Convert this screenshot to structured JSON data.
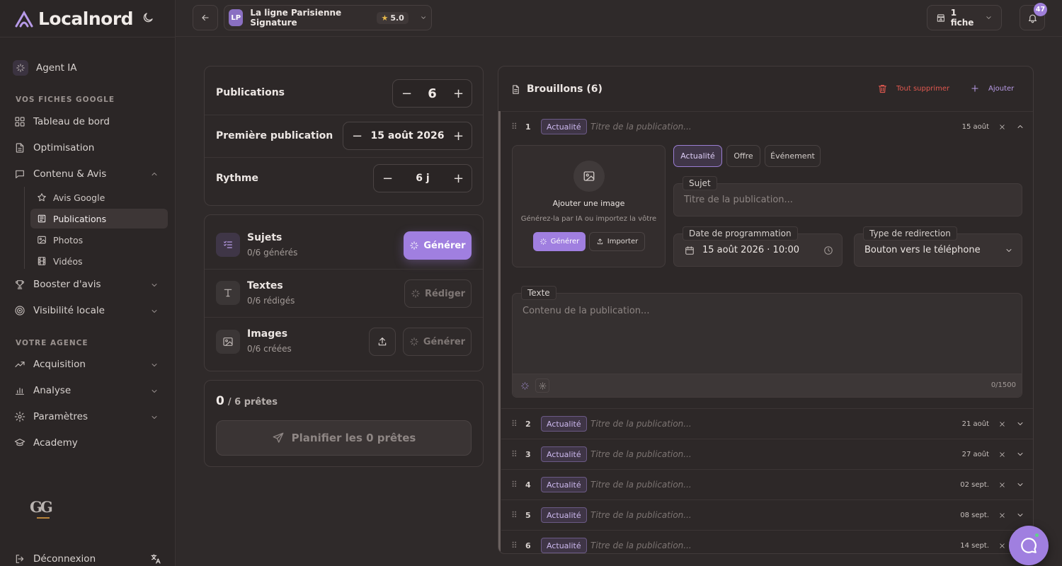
{
  "app": {
    "name": "Localnord"
  },
  "sidebar": {
    "agent": "Agent IA",
    "section_google": "VOS FICHES GOOGLE",
    "items_google": [
      "Tableau de bord",
      "Optimisation",
      "Contenu & Avis"
    ],
    "sub_items": [
      "Avis Google",
      "Publications",
      "Photos",
      "Vidéos"
    ],
    "items_more": [
      "Booster d'avis",
      "Visibilité locale"
    ],
    "section_agency": "VOTRE AGENCE",
    "items_agency": [
      "Acquisition",
      "Analyse",
      "Paramètres",
      "Academy"
    ],
    "agency_logo": "GG",
    "logout": "Déconnexion"
  },
  "topbar": {
    "business_initials": "LP",
    "business_name": "La ligne Parisienne Signature",
    "rating": "5.0",
    "fiches": "1 fiche",
    "notifications": "47"
  },
  "config": {
    "publications_label": "Publications",
    "publications_value": "6",
    "first_label": "Première publication",
    "first_value": "15 août 2026",
    "rhythm_label": "Rythme",
    "rhythm_value": "6 j"
  },
  "tasks": {
    "subjects_title": "Sujets",
    "subjects_sub": "0/6 générés",
    "generate_label": "Générer",
    "texts_title": "Textes",
    "texts_sub": "0/6 rédigés",
    "write_label": "Rédiger",
    "images_title": "Images",
    "images_sub": "0/6 créées",
    "images_generate_label": "Générer"
  },
  "summary": {
    "ready_count": "0",
    "ready_total": "/ 6 prêtes",
    "plan_label": "Planifier les 0 prêtes"
  },
  "drafts": {
    "header": "Brouillons (6)",
    "delete_all": "Tout supprimer",
    "add": "Ajouter",
    "title_placeholder": "Titre de la publication...",
    "tag": "Actualité",
    "rows": [
      {
        "num": "1",
        "date": "15 août"
      },
      {
        "num": "2",
        "date": "21 août"
      },
      {
        "num": "3",
        "date": "27 août"
      },
      {
        "num": "4",
        "date": "02 sept."
      },
      {
        "num": "5",
        "date": "08 sept."
      },
      {
        "num": "6",
        "date": "14 sept."
      }
    ],
    "editor": {
      "add_image": "Ajouter une image",
      "add_image_sub": "Générez-la par IA ou importez la vôtre",
      "gen_btn": "Générer",
      "import_btn": "Importer",
      "types": [
        "Actualité",
        "Offre",
        "Événement"
      ],
      "subject_label": "Sujet",
      "subject_placeholder": "Titre de la publication...",
      "date_label": "Date de programmation",
      "date_value": "15 août 2026 · 10:00",
      "redirect_label": "Type de redirection",
      "redirect_value": "Bouton vers le téléphone",
      "text_label": "Texte",
      "text_placeholder": "Contenu de la publication...",
      "counter": "0/1500"
    }
  },
  "colors": {
    "accent": "#a07fe0",
    "danger": "#e0584f",
    "bg": "#2f2a2a"
  }
}
